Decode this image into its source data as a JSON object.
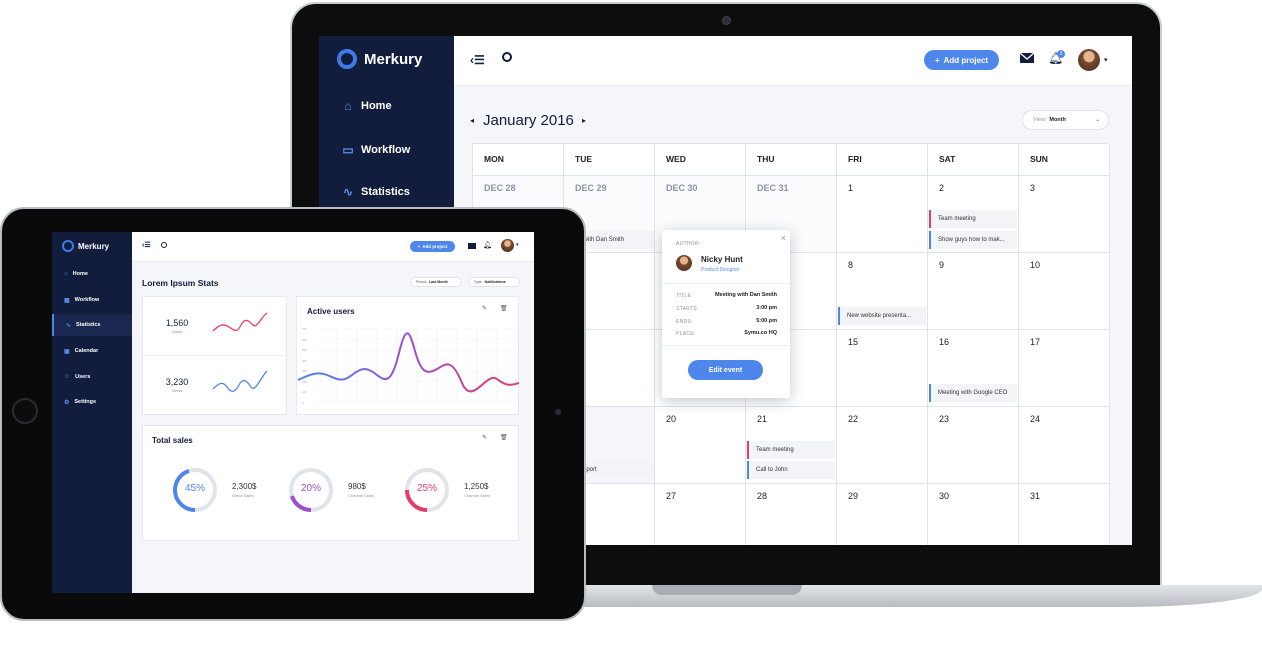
{
  "laptop": {
    "brand": "Merkury",
    "nav": [
      {
        "label": "Home",
        "icon": "home-icon"
      },
      {
        "label": "Workflow",
        "icon": "workflow-icon"
      },
      {
        "label": "Statistics",
        "icon": "statistics-icon"
      }
    ],
    "add_project": "Add project",
    "notification_count": "3",
    "calendar": {
      "month": "January 2016",
      "view_label": "View:",
      "view_value": "Month",
      "days": [
        "MON",
        "TUE",
        "WED",
        "THU",
        "FRI",
        "SAT",
        "SUN"
      ],
      "week1": [
        "DEC 28",
        "DEC 29",
        "DEC 30",
        "DEC 31",
        "1",
        "2",
        "3"
      ],
      "dates": {
        "d8": "8",
        "d9": "9",
        "d10": "10",
        "d15": "15",
        "d16": "16",
        "d17": "17",
        "d20": "20",
        "d21": "21",
        "d22": "22",
        "d23": "23",
        "d24": "24",
        "d27": "27",
        "d28": "28",
        "d29": "29",
        "d30": "30",
        "d31": "31"
      },
      "events": {
        "team_meeting_sat": "Team meeting",
        "show_guys": "Show guys how to mak...",
        "meeting_dan": "eting with Dan Smith",
        "new_website": "New website presenta...",
        "meeting_google": "Meeting with Google CEO",
        "team_meeting_thu": "Team meeting",
        "call_john": "Call to John",
        "annual_report": "ual Report"
      }
    },
    "popup": {
      "author_label": "AUTHOR:",
      "author_name": "Nicky Hunt",
      "author_role": "Product Designer",
      "title_label": "TITLE:",
      "title_value": "Meeting with Dan Smith",
      "starts_label": "STARTS:",
      "starts_value": "3:00 pm",
      "ends_label": "ENDS:",
      "ends_value": "5:00 pm",
      "place_label": "PLACE:",
      "place_value": "Symu.co HQ",
      "edit_button": "Edit event"
    }
  },
  "tablet": {
    "brand": "Merkury",
    "nav": [
      {
        "label": "Home"
      },
      {
        "label": "Workflow"
      },
      {
        "label": "Statistics"
      },
      {
        "label": "Calendar"
      },
      {
        "label": "Users"
      },
      {
        "label": "Settings"
      }
    ],
    "add_project": "Add project",
    "page_title": "Lorem Ipsum Stats",
    "filter_period_label": "Period:",
    "filter_period_value": "Last Month",
    "filter_type_label": "Type:",
    "filter_type_value": "Notifications",
    "sales_value": "1,560",
    "sales_label": "Sales",
    "views_value": "3,230",
    "views_label": "Views",
    "active_users_title": "Active users",
    "active_users_y_ticks": [
      "700",
      "600",
      "500",
      "400",
      "300",
      "200",
      "100",
      "0"
    ],
    "total_sales_title": "Total sales",
    "donuts": [
      {
        "percent": "45%",
        "amount": "2,300$",
        "label": "Direct Sales",
        "color": "#4f86ec",
        "fraction": 0.45
      },
      {
        "percent": "20%",
        "amount": "980$",
        "label": "Channel Sales",
        "color": "#9b4fcf",
        "fraction": 0.2
      },
      {
        "percent": "25%",
        "amount": "1,250$",
        "label": "Channel Sales",
        "color": "#e83a6b",
        "fraction": 0.25
      }
    ]
  },
  "colors": {
    "accent": "#4f86ec",
    "sidebar": "#121d3d",
    "pink": "#e83a6b",
    "purple": "#9b4fcf"
  }
}
